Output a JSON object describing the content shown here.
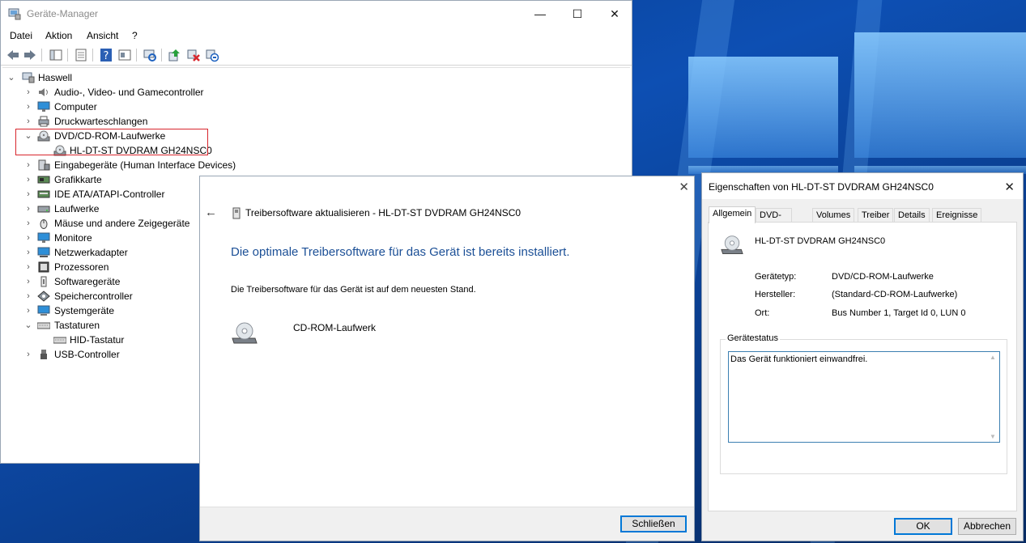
{
  "colors": {
    "accent_blue": "#1b4f96",
    "highlight_red": "#d8262d",
    "focus_blue": "#0078d7",
    "dialog_bg": "#f0f0f0"
  },
  "device_manager": {
    "title": "Geräte-Manager",
    "menu": [
      "Datei",
      "Aktion",
      "Ansicht",
      "?"
    ],
    "toolbar_icons": [
      "back-arrow-icon",
      "forward-arrow-icon",
      "show-hide-tree-icon",
      "properties-icon",
      "help-icon",
      "view-icon",
      "scan-hardware-icon",
      "update-driver-icon",
      "uninstall-device-icon",
      "disable-device-icon"
    ],
    "tree": {
      "root": "Haswell",
      "items": [
        {
          "label": "Audio-, Video- und Gamecontroller",
          "icon": "speaker-icon",
          "expanded": false
        },
        {
          "label": "Computer",
          "icon": "monitor-icon",
          "expanded": false
        },
        {
          "label": "Druckwarteschlangen",
          "icon": "printer-icon",
          "expanded": false
        },
        {
          "label": "DVD/CD-ROM-Laufwerke",
          "icon": "disc-drive-icon",
          "expanded": true,
          "children": [
            "HL-DT-ST DVDRAM GH24NSC0"
          ]
        },
        {
          "label": "Eingabegeräte (Human Interface Devices)",
          "icon": "hid-icon",
          "expanded": false
        },
        {
          "label": "Grafikkarte",
          "icon": "graphics-card-icon",
          "expanded": false
        },
        {
          "label": "IDE ATA/ATAPI-Controller",
          "icon": "ide-controller-icon",
          "expanded": false
        },
        {
          "label": "Laufwerke",
          "icon": "drive-icon",
          "expanded": false
        },
        {
          "label": "Mäuse und andere Zeigegeräte",
          "icon": "mouse-icon",
          "expanded": false
        },
        {
          "label": "Monitore",
          "icon": "monitor-icon",
          "expanded": false
        },
        {
          "label": "Netzwerkadapter",
          "icon": "network-adapter-icon",
          "expanded": false
        },
        {
          "label": "Prozessoren",
          "icon": "processor-icon",
          "expanded": false
        },
        {
          "label": "Softwaregeräte",
          "icon": "software-device-icon",
          "expanded": false
        },
        {
          "label": "Speichercontroller",
          "icon": "storage-controller-icon",
          "expanded": false
        },
        {
          "label": "Systemgeräte",
          "icon": "system-device-icon",
          "expanded": false
        },
        {
          "label": "Tastaturen",
          "icon": "keyboard-icon",
          "expanded": true,
          "children": [
            "HID-Tastatur"
          ]
        },
        {
          "label": "USB-Controller",
          "icon": "usb-icon",
          "expanded": false
        }
      ]
    }
  },
  "driver_update": {
    "title": "Treibersoftware aktualisieren - HL-DT-ST DVDRAM GH24NSC0",
    "heading": "Die optimale Treibersoftware für das Gerät ist bereits installiert.",
    "message": "Die Treibersoftware für das Gerät ist auf dem neuesten Stand.",
    "device_name": "CD-ROM-Laufwerk",
    "close_button": "Schließen"
  },
  "properties": {
    "title": "Eigenschaften von HL-DT-ST DVDRAM GH24NSC0",
    "tabs": [
      "Allgemein",
      "DVD-Region",
      "Volumes",
      "Treiber",
      "Details",
      "Ereignisse"
    ],
    "active_tab": "Allgemein",
    "device_name": "HL-DT-ST DVDRAM GH24NSC0",
    "fields": [
      {
        "label": "Gerätetyp:",
        "value": "DVD/CD-ROM-Laufwerke"
      },
      {
        "label": "Hersteller:",
        "value": "(Standard-CD-ROM-Laufwerke)"
      },
      {
        "label": "Ort:",
        "value": "Bus Number 1, Target Id 0, LUN 0"
      }
    ],
    "status_group_title": "Gerätestatus",
    "status_text": "Das Gerät funktioniert einwandfrei.",
    "ok_button": "OK",
    "cancel_button": "Abbrechen"
  }
}
